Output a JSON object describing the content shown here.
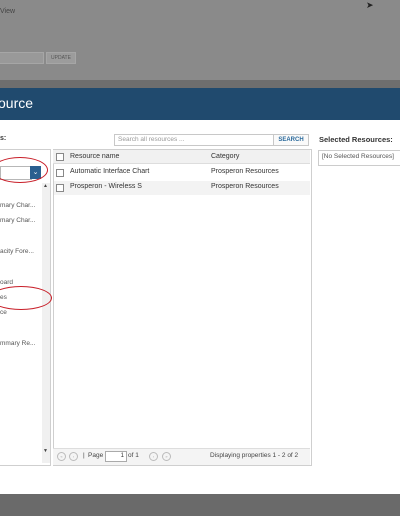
{
  "background": {
    "view_label": "View",
    "update_button": "UPDATE"
  },
  "dialog": {
    "title": "ource",
    "left_label": "s:",
    "search_placeholder": "Search all resources ...",
    "search_button": "SEARCH",
    "selected_title": "Selected Resources:",
    "selected_empty": "[No Selected Resources]"
  },
  "tree": {
    "items": [
      "mary Char...",
      "mary Char...",
      "acity Fore...",
      "oard",
      "es",
      "ce",
      "mmary Re..."
    ]
  },
  "grid": {
    "columns": [
      "Resource name",
      "Category"
    ],
    "rows": [
      {
        "name": "Automatic Interface Chart",
        "category": "Prosperon Resources"
      },
      {
        "name": "Prosperon - Wireless S",
        "category": "Prosperon Resources"
      }
    ]
  },
  "pager": {
    "page_label": "Page",
    "page_value": "1",
    "of_label": "of 1",
    "display_text": "Displaying properties 1 - 2 of 2"
  },
  "colors": {
    "header": "#204a6e",
    "highlight": "#c81e28"
  }
}
